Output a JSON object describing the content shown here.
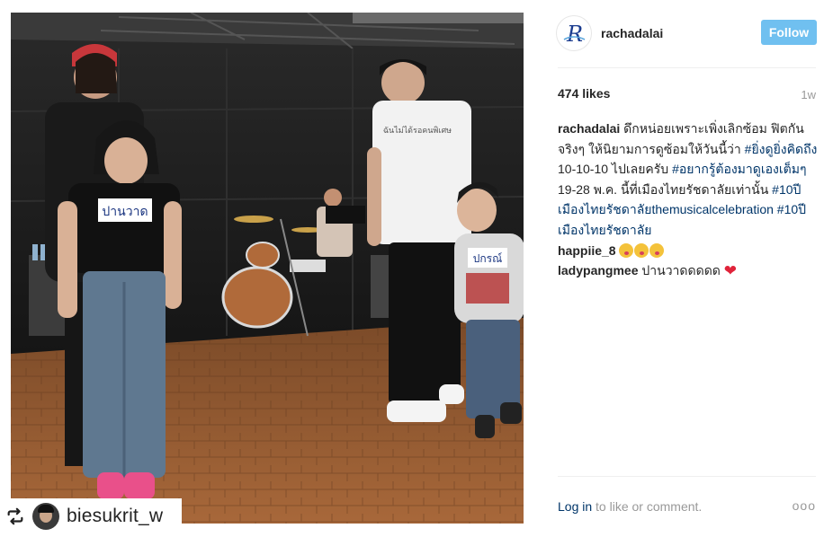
{
  "post": {
    "repost_username": "biesukrit_w"
  },
  "header": {
    "username": "rachadalai",
    "follow_label": "Follow",
    "avatar_letter": "R"
  },
  "stats": {
    "likes": "474 likes",
    "time": "1w"
  },
  "caption": {
    "user": "rachadalai",
    "text_1": " ดึกหน่อยเพราะเพิ่งเลิกซ้อม ฟิตกันจริงๆ ให้นิยามการดูซ้อมให้วันนี้ว่า ",
    "tag_1": "#ยิ่งดูยิ่งคิดถึง",
    "text_2": " 10-10-10 ไปเลยครับ ",
    "tag_2": "#อยากรู้ต้องมาดูเองเต็มๆ",
    "text_3": " 19-28 พ.ค. นี้ที่เมืองไทยรัชดาลัยเท่านั้น ",
    "tag_3": "#10ปีเมืองไทยรัชดาลัยthemusicalcelebration",
    "text_4": " ",
    "tag_4": "#10ปีเมืองไทยรัชดาลัย"
  },
  "comments": [
    {
      "user": "happiie_8",
      "text": ""
    },
    {
      "user": "ladypangmee",
      "text": " ปานวาดดดดด "
    }
  ],
  "footer": {
    "login_label": "Log in",
    "rest_label": " to like or comment.",
    "more_label": "ooo"
  },
  "photo": {
    "shirt_text_left": "ปานวาด",
    "shirt_text_right": "ปกรณ์"
  }
}
